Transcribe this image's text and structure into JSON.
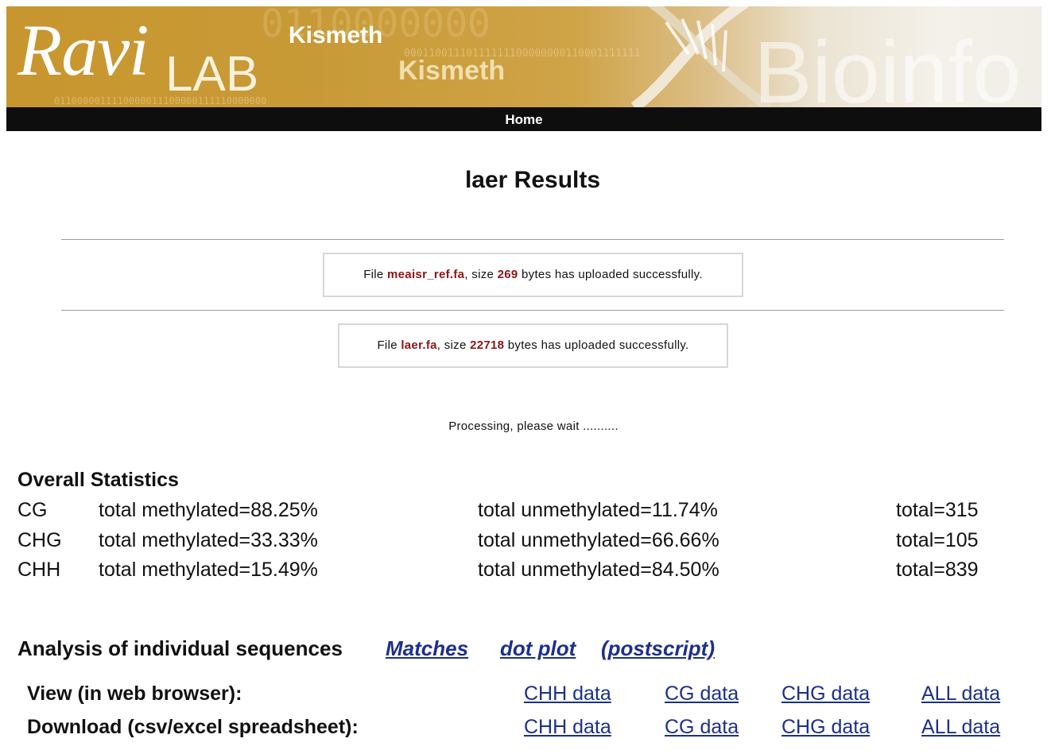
{
  "banner": {
    "logo_script": "Ravi",
    "logo_lab": "LAB",
    "app_name_primary": "Kismeth",
    "app_name_secondary": "Kismeth",
    "bg_word": "Bioinfo"
  },
  "nav": {
    "home_label": "Home"
  },
  "page": {
    "title": "laer Results"
  },
  "uploads": [
    {
      "prefix": "File ",
      "filename": "meaisr_ref.fa",
      "size_prefix": ", size ",
      "size": "269",
      "suffix": " bytes has uploaded successfully."
    },
    {
      "prefix": "File ",
      "filename": "laer.fa",
      "size_prefix": ", size ",
      "size": "22718",
      "suffix": " bytes has uploaded successfully."
    }
  ],
  "processing_text": "Processing, please wait ..........",
  "stats": {
    "heading": "Overall Statistics",
    "rows": [
      {
        "type": "CG",
        "methylated": "total methylated=88.25%",
        "unmethylated": "total unmethylated=11.74%",
        "total": "total=315"
      },
      {
        "type": "CHG",
        "methylated": "total methylated=33.33%",
        "unmethylated": "total unmethylated=66.66%",
        "total": "total=105"
      },
      {
        "type": "CHH",
        "methylated": "total methylated=15.49%",
        "unmethylated": "total unmethylated=84.50%",
        "total": "total=839"
      }
    ]
  },
  "analysis": {
    "heading": "Analysis of individual sequences",
    "links": [
      "Matches",
      "dot plot",
      "(postscript)"
    ],
    "view_label": "View (in web browser):",
    "download_label": "Download (csv/excel spreadsheet):",
    "data_links": [
      "CHH data",
      "CG data",
      "CHG data",
      "ALL data"
    ]
  },
  "colors": {
    "banner_gold": "#c8962e",
    "nav_bg": "#0e0e0e",
    "link_blue": "#1c2f8c",
    "highlight_red": "#8b1515"
  }
}
